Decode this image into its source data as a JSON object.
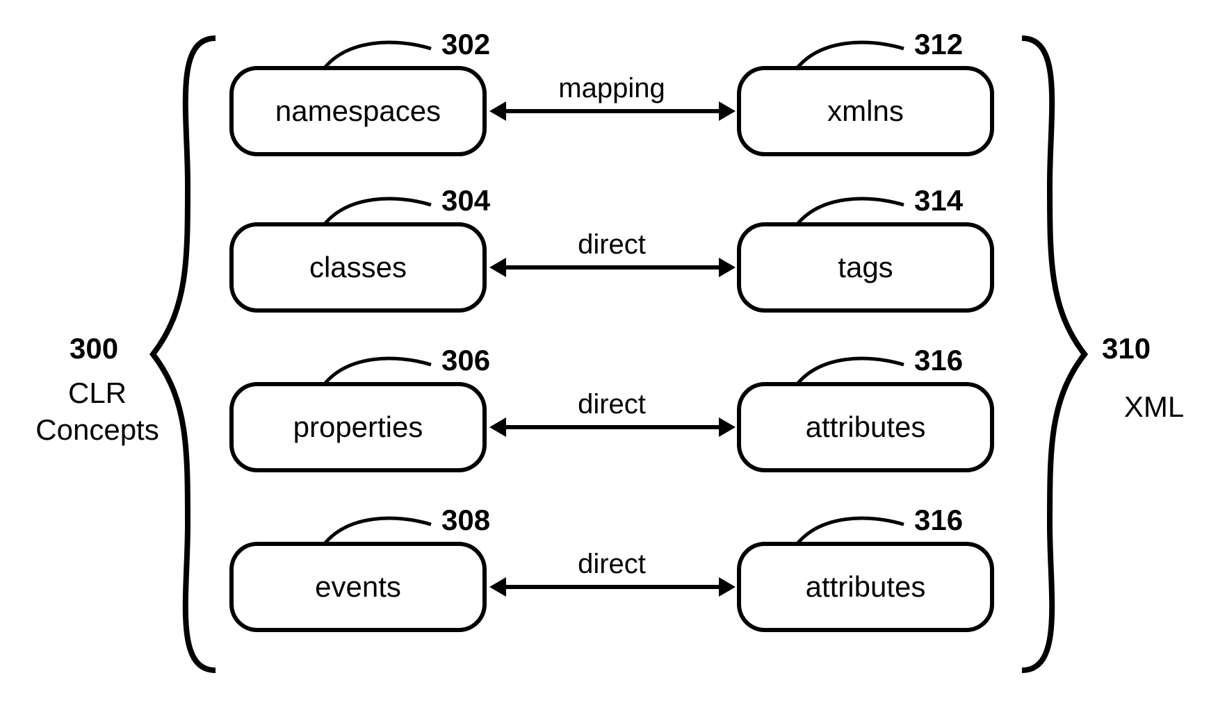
{
  "left_group": {
    "ref": "300",
    "label_line1": "CLR",
    "label_line2": "Concepts"
  },
  "right_group": {
    "ref": "310",
    "label": "XML"
  },
  "rows": [
    {
      "left_ref": "302",
      "left_text": "namespaces",
      "edge_label": "mapping",
      "right_ref": "312",
      "right_text": "xmlns"
    },
    {
      "left_ref": "304",
      "left_text": "classes",
      "edge_label": "direct",
      "right_ref": "314",
      "right_text": "tags"
    },
    {
      "left_ref": "306",
      "left_text": "properties",
      "edge_label": "direct",
      "right_ref": "316",
      "right_text": "attributes"
    },
    {
      "left_ref": "308",
      "left_text": "events",
      "edge_label": "direct",
      "right_ref": "316",
      "right_text": "attributes"
    }
  ]
}
